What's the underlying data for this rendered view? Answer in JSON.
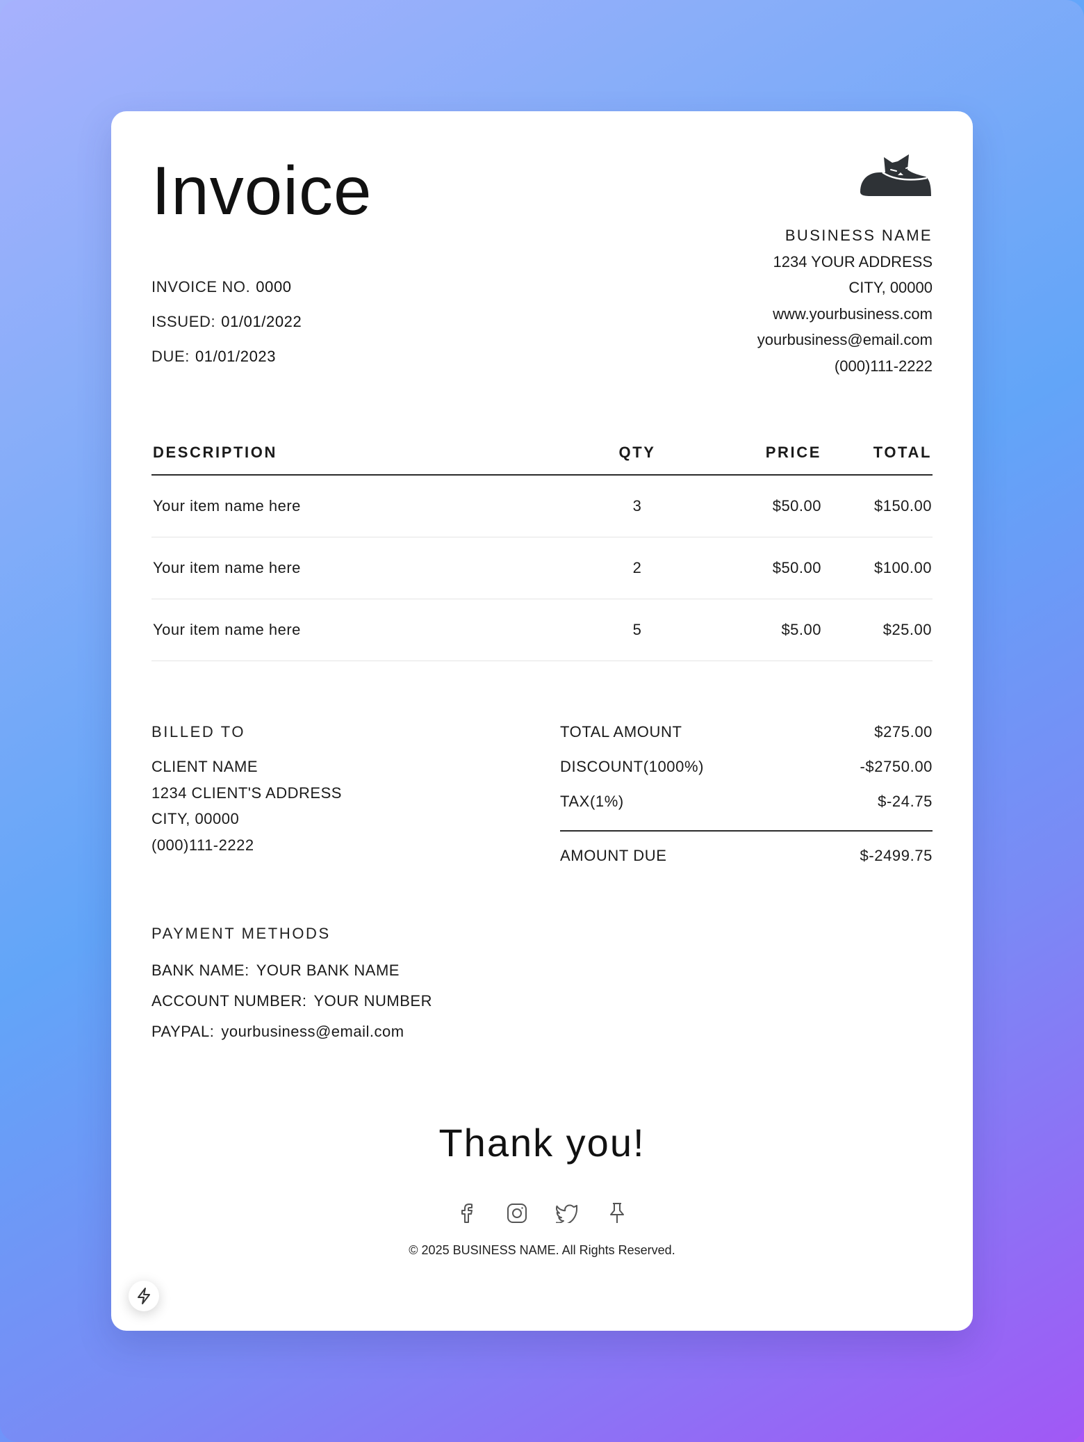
{
  "invoice": {
    "title": "Invoice",
    "number_label": "INVOICE NO.",
    "number": "0000",
    "issued_label": "ISSUED:",
    "issued": "01/01/2022",
    "due_label": "DUE:",
    "due": "01/01/2023"
  },
  "business": {
    "logo_icon": "cat-logo-icon",
    "name": "BUSINESS NAME",
    "address": "1234 YOUR ADDRESS",
    "city": "CITY, 00000",
    "website": "www.yourbusiness.com",
    "email": "yourbusiness@email.com",
    "phone": "(000)111-2222"
  },
  "table": {
    "headers": {
      "description": "DESCRIPTION",
      "qty": "QTY",
      "price": "PRICE",
      "total": "TOTAL"
    },
    "rows": [
      {
        "description": "Your item name here",
        "qty": "3",
        "price": "$50.00",
        "total": "$150.00"
      },
      {
        "description": "Your item name here",
        "qty": "2",
        "price": "$50.00",
        "total": "$100.00"
      },
      {
        "description": "Your item name here",
        "qty": "5",
        "price": "$5.00",
        "total": "$25.00"
      }
    ]
  },
  "billed_to": {
    "label": "BILLED TO",
    "client_name": "CLIENT NAME",
    "address": "1234 CLIENT'S ADDRESS",
    "city": "CITY, 00000",
    "phone": "(000)111-2222"
  },
  "totals": {
    "total_label": "TOTAL AMOUNT",
    "total": "$275.00",
    "discount_label": "DISCOUNT(1000%)",
    "discount": "-$2750.00",
    "tax_label": "TAX(1%)",
    "tax": "$-24.75",
    "due_label": "AMOUNT DUE",
    "due": "$-2499.75"
  },
  "payment": {
    "label": "PAYMENT METHODS",
    "bank_label": "BANK NAME:",
    "bank": "YOUR BANK NAME",
    "account_label": "ACCOUNT NUMBER:",
    "account": "YOUR NUMBER",
    "paypal_label": "PAYPAL:",
    "paypal": "yourbusiness@email.com"
  },
  "footer": {
    "thanks": "Thank you!",
    "social_icons": [
      "facebook-icon",
      "instagram-icon",
      "twitter-icon",
      "pin-icon"
    ],
    "copyright": "© 2025 BUSINESS NAME. All Rights Reserved."
  },
  "fab_icon": "lightning-icon",
  "colors": {
    "background_gradient": [
      "#a7b1fd",
      "#62a5f8",
      "#a158f5"
    ],
    "card": "#ffffff",
    "text": "#1a1a1a",
    "logo": "#2e3236"
  }
}
